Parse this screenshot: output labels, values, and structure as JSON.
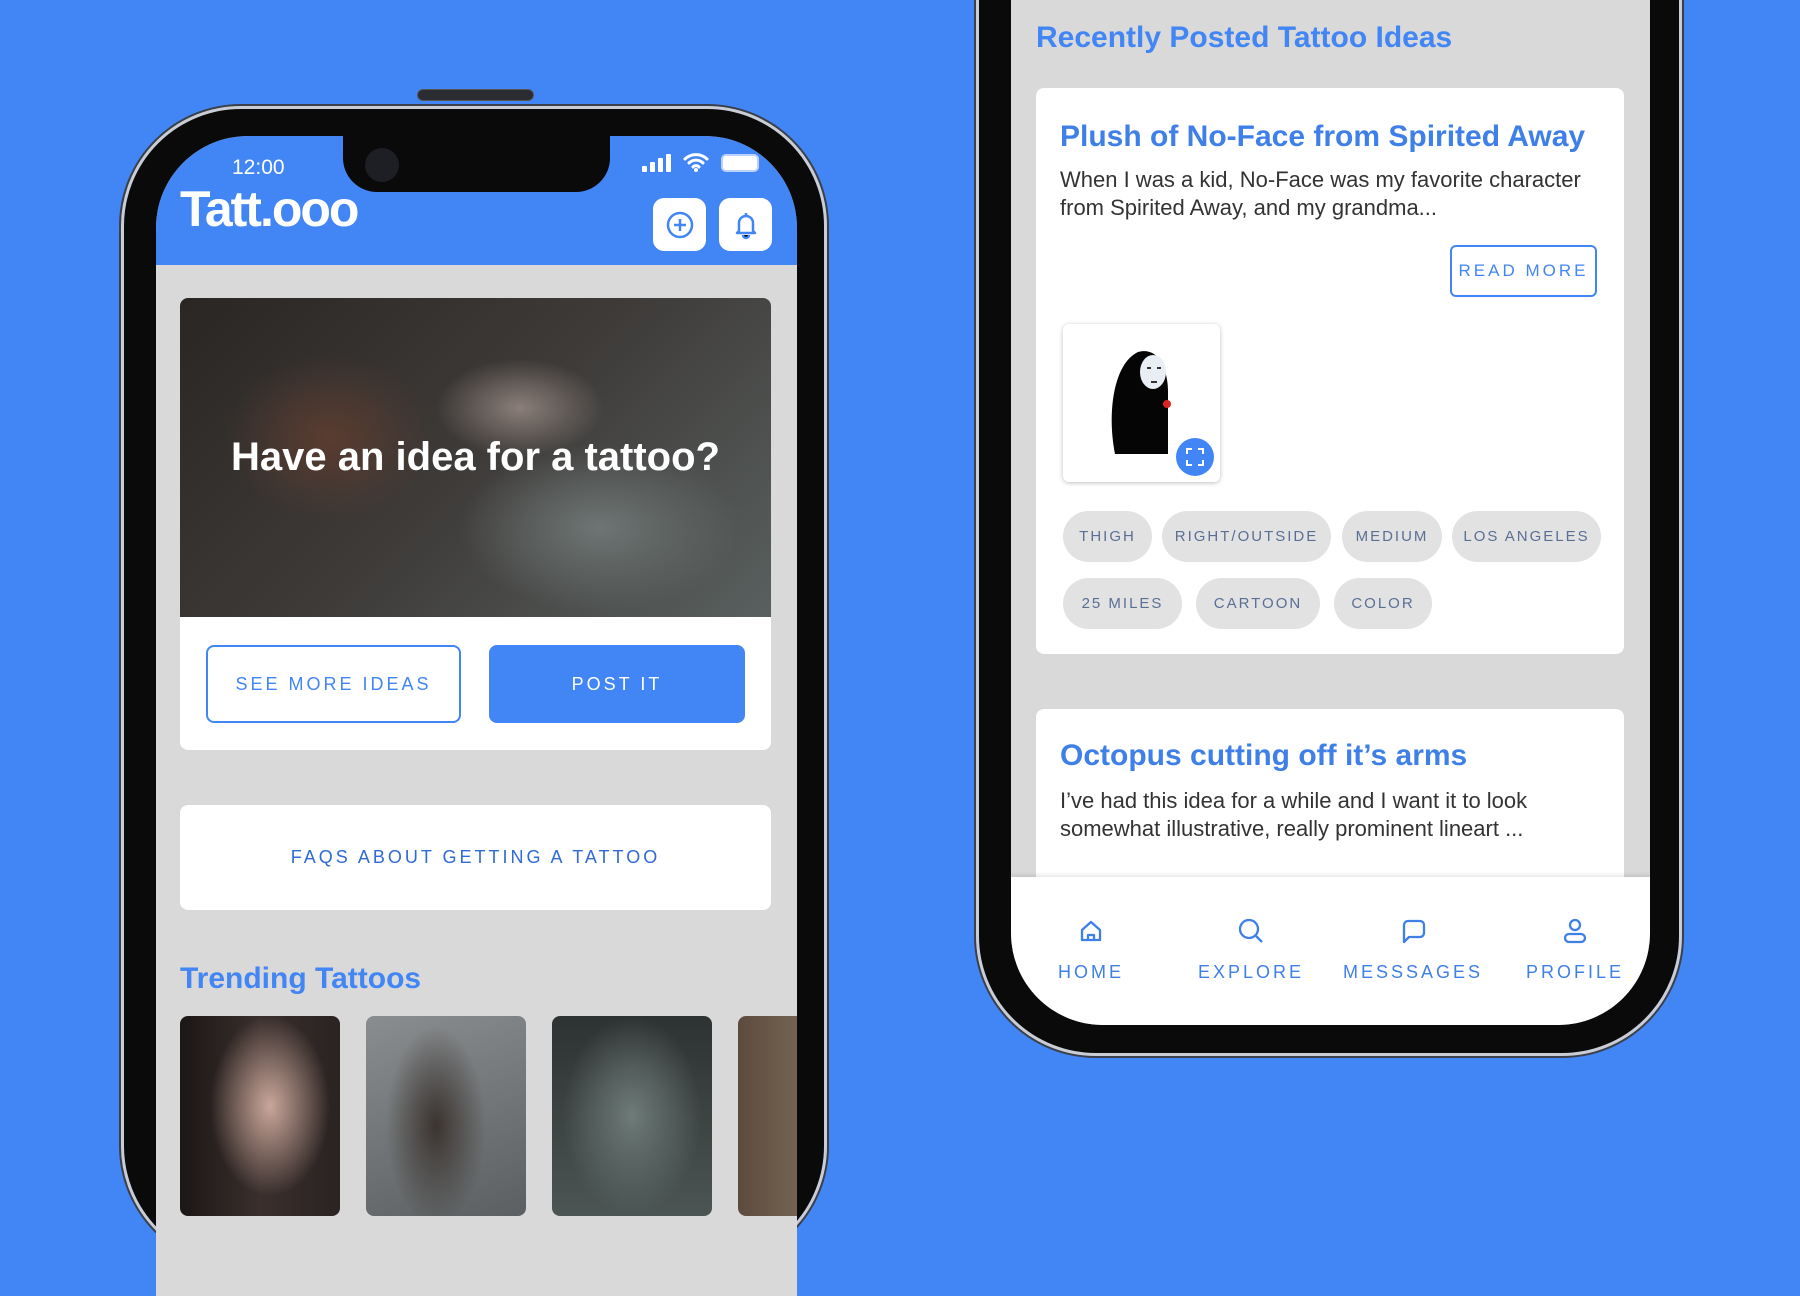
{
  "colors": {
    "accent": "#4285f4",
    "background": "#4285f4",
    "content": "#d9d9d9"
  },
  "left_screen": {
    "status": {
      "time": "12:00",
      "icons": [
        "signal-icon",
        "wifi-icon",
        "battery-icon"
      ]
    },
    "header": {
      "logo": "Tatt.ooo",
      "buttons": [
        {
          "icon": "plus-circle-icon"
        },
        {
          "icon": "bell-icon"
        }
      ]
    },
    "hero": {
      "headline": "Have an idea for a tattoo?",
      "see_more": "SEE MORE IDEAS",
      "post": "POST IT"
    },
    "faq": "FAQS ABOUT GETTING A TATTOO",
    "trending": {
      "title": "Trending Tattoos"
    }
  },
  "right_screen": {
    "heading": "Recently Posted Tattoo Ideas",
    "posts": [
      {
        "title": "Plush of No-Face from Spirited Away",
        "desc": "When I was a kid, No-Face was my favorite character from Spirited Away, and my grandma...",
        "read_more": "READ MORE",
        "tags": [
          "THIGH",
          "RIGHT/OUTSIDE",
          "MEDIUM",
          "LOS ANGELES",
          "25 MILES",
          "CARTOON",
          "COLOR"
        ]
      },
      {
        "title": "Octopus cutting off it’s arms",
        "desc": "I’ve had this idea for a while and I want it to look somewhat illustrative, really prominent lineart ..."
      }
    ],
    "nav": [
      {
        "label": "HOME",
        "icon": "home-icon"
      },
      {
        "label": "EXPLORE",
        "icon": "search-icon"
      },
      {
        "label": "MESSSAGES",
        "icon": "message-icon"
      },
      {
        "label": "PROFILE",
        "icon": "user-icon"
      }
    ]
  }
}
